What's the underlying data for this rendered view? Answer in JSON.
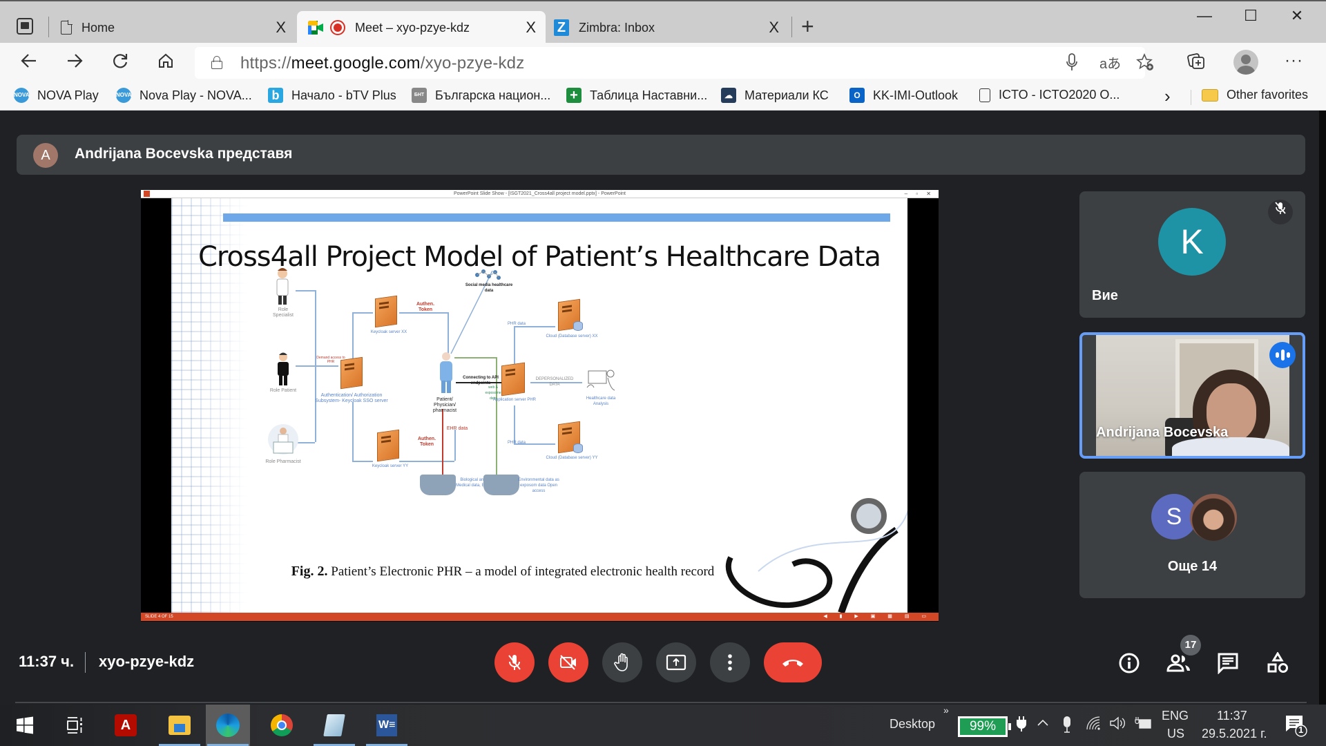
{
  "browser": {
    "tabs": [
      {
        "title": "Home",
        "icon": "document-icon",
        "active": false
      },
      {
        "title": "Meet – xyo-pzye-kdz",
        "icon": "google-meet-icon",
        "recording": true,
        "active": true
      },
      {
        "title": "Zimbra: Inbox",
        "icon": "zimbra-icon",
        "active": false
      }
    ],
    "tab_close_glyph": "X",
    "new_tab_glyph": "+",
    "window_controls": {
      "minimize": "—",
      "maximize": "☐",
      "close": "✕"
    },
    "url": {
      "scheme": "https://",
      "host": "meet.google.com",
      "path": "/xyo-pzye-kdz"
    },
    "bookmarks": [
      {
        "label": "NOVA Play",
        "icon": "nova-icon",
        "icon_text": "NOVA"
      },
      {
        "label": "Nova Play - NOVA...",
        "icon": "nova-icon",
        "icon_text": "NOVA"
      },
      {
        "label": "Начало - bTV Plus",
        "icon": "btv-icon",
        "icon_text": "b"
      },
      {
        "label": "Българска национ...",
        "icon": "bnt-icon",
        "icon_text": "БНТ"
      },
      {
        "label": "Таблица Наставни...",
        "icon": "sheets-icon",
        "icon_text": "+"
      },
      {
        "label": "Материали  КС",
        "icon": "cloud-icon",
        "icon_text": "☁"
      },
      {
        "label": "KK-IMI-Outlook",
        "icon": "outlook-icon",
        "icon_text": "O"
      },
      {
        "label": "ICTO - ICTO2020 O...",
        "icon": "file-icon",
        "icon_text": ""
      }
    ],
    "bookmarks_overflow_glyph": "›",
    "other_favorites": "Other favorites"
  },
  "meet": {
    "presenter": {
      "initial": "A",
      "text": "Andrijana Bocevska представя",
      "avatar_color": "#a1776a"
    },
    "slide_window": {
      "title": "PowerPoint Slide Show - [ISGT2021_Cross4all project model.pptx] - PowerPoint",
      "controls": "–  ▫  ✕",
      "status_left": "SLIDE 4 OF 15",
      "status_controls": "◀ ▮ ▶ ▣ ▦ ▤ ▭"
    },
    "slide": {
      "title": "Cross4all Project Model of Patient’s Healthcare Data",
      "caption_bold": "Fig. 2.",
      "caption_text": " Patient’s Electronic PHR – a model of integrated electronic health record",
      "diagram": {
        "roles": [
          "Role Specialist",
          "Role Patient",
          "Role Pharmacist"
        ],
        "demand_access": "Demand access to PHR",
        "auth_server": "Authentication/ Authorization Subsystem- Keycloak SSO server",
        "keycloak_xx": "Keycloak server XX",
        "keycloak_yy": "Keycloak server YY",
        "authen_token": "Authen. Token",
        "social_media": "Social media healthcare data",
        "patient_node": "Patient/ Physician/ pharmacist",
        "connecting": "Connecting to API endpoints",
        "web_exposome": "web & exposome data",
        "app_server": "Application server PHR",
        "phr_data": "PHR data",
        "cloud_xx": "Cloud (Database server) XX",
        "cloud_yy": "Cloud (Database server) YY",
        "depersonalized": "DEPERSONALIZED DATA",
        "analysis": "Healthcare data Analysis",
        "ehr_data": "EHR data",
        "bio_medical": "Biological and Medical data, EHP",
        "environmental": "Environmental data as exposom data Open access"
      }
    },
    "participants": [
      {
        "name": "Вие",
        "initial": "K",
        "avatar_color": "#1e93a6",
        "muted": true
      },
      {
        "name": "Andrijana Bocevska",
        "video": true,
        "speaking": true
      },
      {
        "label": "Още 14",
        "initial": "S",
        "avatar_color": "#5c6bc0",
        "more_count": 14
      }
    ],
    "bottom_bar": {
      "time": "11:37 ч.",
      "meeting_code": "xyo-pzye-kdz",
      "controls": [
        {
          "name": "microphone-off",
          "state": "off"
        },
        {
          "name": "camera-off",
          "state": "off"
        },
        {
          "name": "raise-hand"
        },
        {
          "name": "present-now"
        },
        {
          "name": "more-options"
        },
        {
          "name": "leave-call"
        }
      ],
      "people_count": "17"
    },
    "colors": {
      "danger": "#ea4335",
      "background": "#202124",
      "tile": "#3c4043",
      "speaking_border": "#669df6"
    }
  },
  "taskbar": {
    "apps": [
      "start",
      "task-view",
      "acrobat",
      "file-explorer",
      "edge",
      "chrome",
      "notepad",
      "word"
    ],
    "desktop_label": "Desktop",
    "overflow_glyph": "»",
    "battery_percent": "99%",
    "language_top": "ENG",
    "language_bottom": "US",
    "clock_time": "11:37",
    "clock_date": "29.5.2021 г.",
    "notification_count": "1"
  }
}
